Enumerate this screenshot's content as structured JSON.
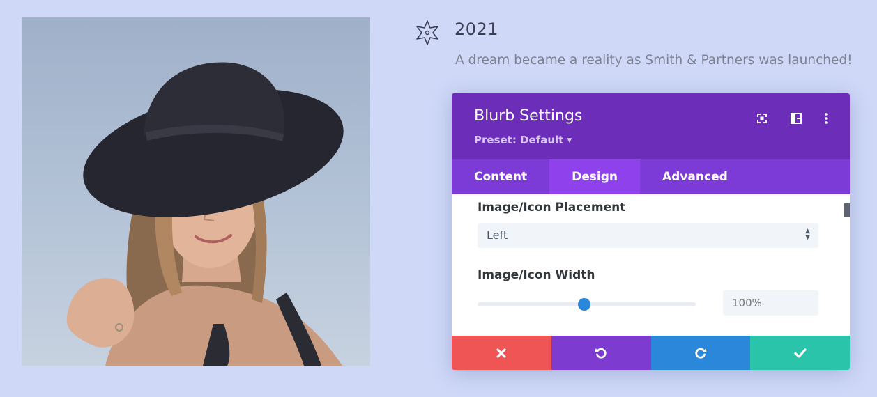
{
  "photo": {
    "icon": "portrait-photo",
    "subject": "woman-in-black-hat"
  },
  "timeline": {
    "icon": "star-icon",
    "year": "2021",
    "description": "A dream became a reality as Smith & Partners was launched!"
  },
  "modal": {
    "title": "Blurb Settings",
    "preset": "Preset: Default",
    "header_icons": [
      "expand-icon",
      "split-view-icon",
      "more-options-icon"
    ],
    "tabs": [
      {
        "label": "Content",
        "active": false
      },
      {
        "label": "Design",
        "active": true
      },
      {
        "label": "Advanced",
        "active": false
      }
    ],
    "fields": {
      "placement_label": "Image/Icon Placement",
      "placement_value": "Left",
      "width_label": "Image/Icon Width",
      "width_placeholder": "100%",
      "width_slider_level": 0.49
    },
    "footer": {
      "buttons": [
        "close-icon",
        "undo-icon",
        "redo-icon",
        "check-icon"
      ]
    }
  },
  "colors": {
    "page_background": "#cfd8f7",
    "header_purple": "#6c2eb9",
    "tabs_purple": "#7c3ad7",
    "active_tab": "#8f42ec",
    "cancel_red": "#ef5555",
    "undo_purple": "#7e3bd0",
    "redo_blue": "#2b87da",
    "save_green": "#29c4a9"
  }
}
